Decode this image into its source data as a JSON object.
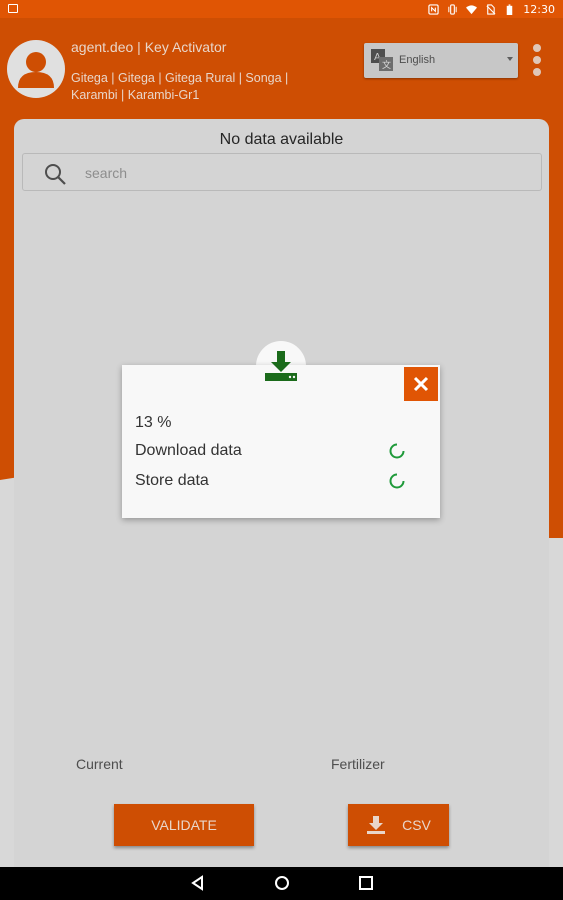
{
  "status_bar": {
    "time": "12:30",
    "icons": [
      "nfc-icon",
      "vibrate-icon",
      "wifi-icon",
      "no-sim-icon",
      "battery-icon"
    ]
  },
  "colors": {
    "accent": "#e05504",
    "success": "#1b7a1b",
    "background": "#e6e6e6"
  },
  "header": {
    "agent_title": "agent.deo | Key Activator",
    "location": "Gitega | Gitega | Gitega Rural | Songa | Karambi | Karambi-Gr1",
    "language": "English"
  },
  "main": {
    "no_data_text": "No data available",
    "search_placeholder": "search",
    "footer_left_label": "Current",
    "footer_right_label": "Fertilizer",
    "validate_label": "VALIDATE",
    "csv_label": "CSV"
  },
  "dialog": {
    "progress_text": "13 %",
    "progress_fraction": 0.13,
    "steps": [
      {
        "label": "Download data",
        "state": "loading"
      },
      {
        "label": "Store data",
        "state": "loading"
      }
    ]
  }
}
